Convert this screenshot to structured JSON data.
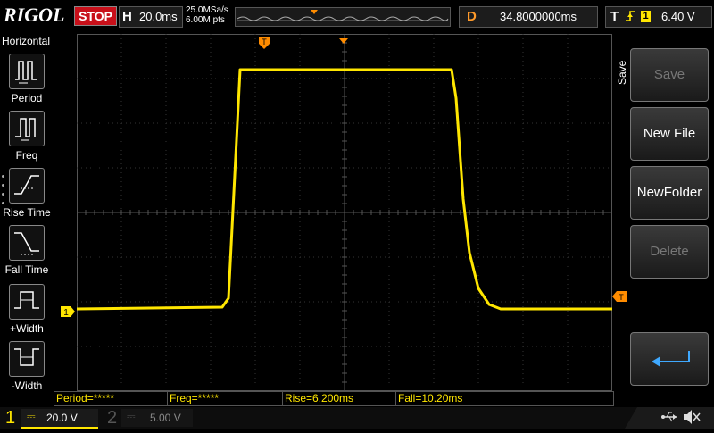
{
  "header": {
    "brand": "RIGOL",
    "run_state": "STOP",
    "horizontal_label": "H",
    "timebase": "20.0ms",
    "sample_rate": "25.0MSa/s",
    "memory_depth": "6.00M pts",
    "delay_label": "D",
    "delay_value": "34.8000000ms",
    "trigger_label": "T",
    "trigger_edge": "rising-edge-icon",
    "trigger_source": "1",
    "trigger_level": "6.40 V"
  },
  "left_panel": {
    "title": "Horizontal",
    "items": [
      {
        "label": "Period",
        "icon": "period-icon"
      },
      {
        "label": "Freq",
        "icon": "freq-icon"
      },
      {
        "label": "Rise Time",
        "icon": "rise-time-icon"
      },
      {
        "label": "Fall Time",
        "icon": "fall-time-icon"
      },
      {
        "label": "+Width",
        "icon": "positive-width-icon"
      },
      {
        "label": "-Width",
        "icon": "negative-width-icon"
      }
    ]
  },
  "right_menu": {
    "title": "Save",
    "buttons": [
      {
        "label": "Save",
        "enabled": false
      },
      {
        "label": "New File",
        "enabled": true
      },
      {
        "label": "NewFolder",
        "enabled": true
      },
      {
        "label": "Delete",
        "enabled": false
      },
      {
        "label": "",
        "icon": "enter-icon",
        "enabled": true
      }
    ]
  },
  "markers": {
    "ch1_ground": "1",
    "trigger_pos": "T",
    "trigger_level": "T"
  },
  "measurements": [
    "Period=*****",
    "Freq=*****",
    "Rise=6.200ms",
    "Fall=10.20ms",
    ""
  ],
  "channels": {
    "ch1": {
      "number": "1",
      "scale": "20.0 V",
      "color": "#ffe600"
    },
    "ch2": {
      "number": "2",
      "scale": "5.00 V",
      "color": "#555555"
    }
  },
  "status_icons": [
    "usb-icon",
    "speaker-muted-icon"
  ],
  "colors": {
    "trace": "#ffe600",
    "stop": "#c8101a",
    "marker": "#ff8c00"
  }
}
